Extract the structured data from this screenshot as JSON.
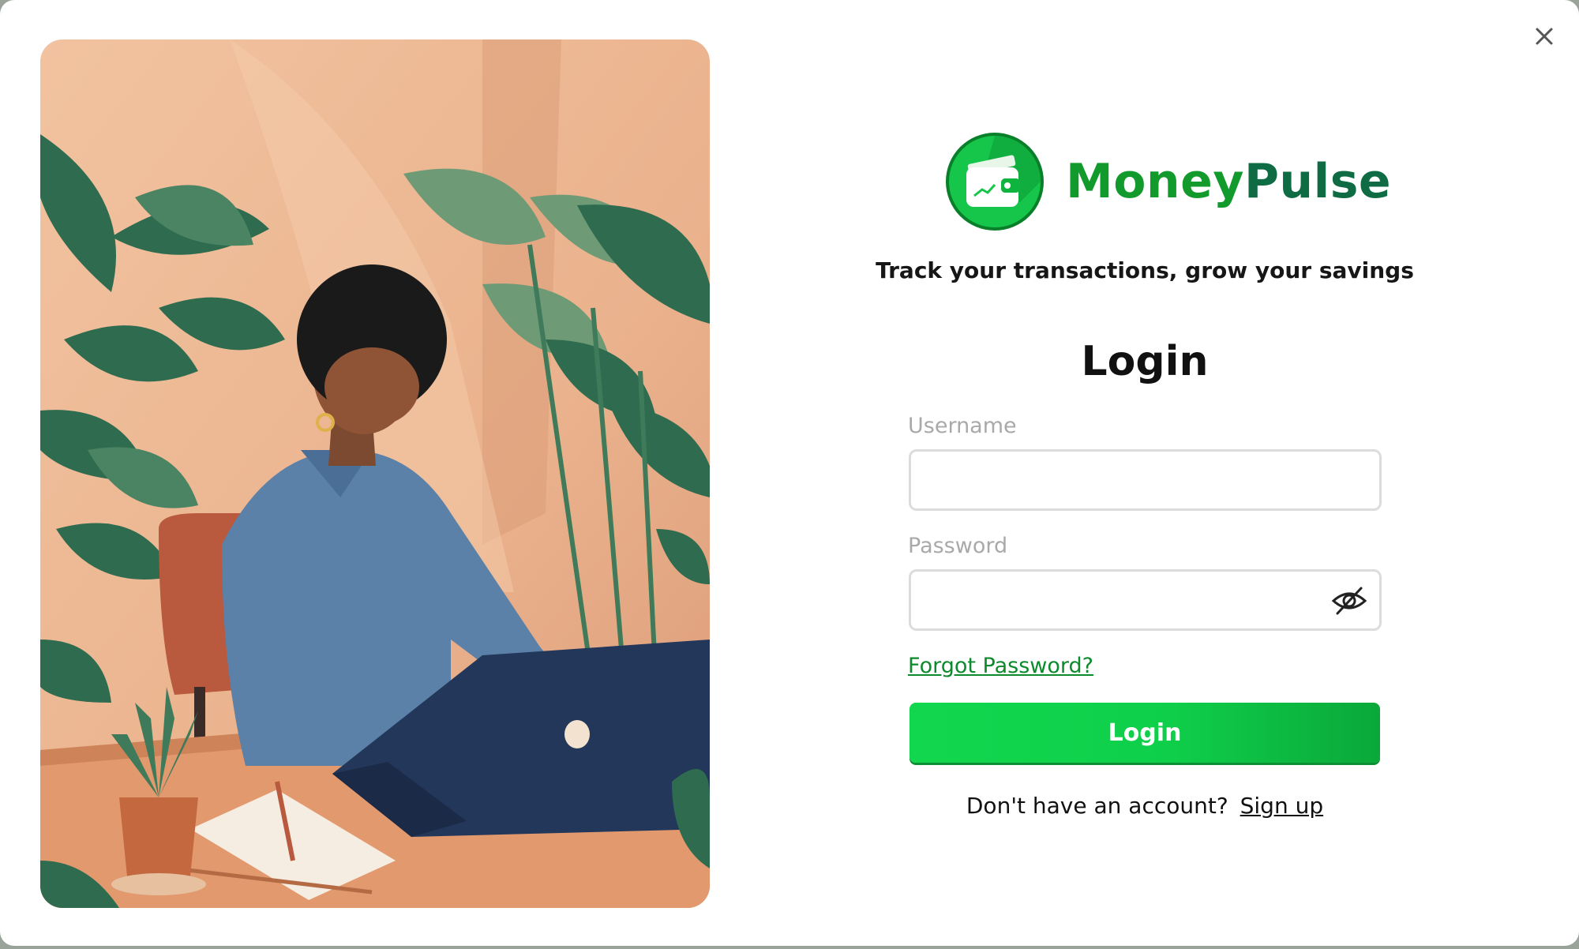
{
  "window": {
    "close_icon": "close-icon"
  },
  "illustration": {
    "subject": "illustration"
  },
  "brand": {
    "logo_icon": "wallet-icon",
    "name_part1": "Money",
    "name_part2": "Pulse",
    "color_part1": "#139a2c",
    "color_part2": "#0f6b44"
  },
  "tagline": "Track your transactions, grow your savings",
  "form": {
    "title": "Login",
    "username_label": "Username",
    "username_value": "",
    "password_label": "Password",
    "password_value": "",
    "password_toggle_icon": "eye-off-icon",
    "forgot_password": "Forgot Password?",
    "submit_label": "Login",
    "signup_prompt": "Don't have an account?",
    "signup_link": "Sign up"
  },
  "colors": {
    "accent": "#0fcf4a",
    "accent_dark": "#0a8f33",
    "link": "#0c8a2c"
  }
}
